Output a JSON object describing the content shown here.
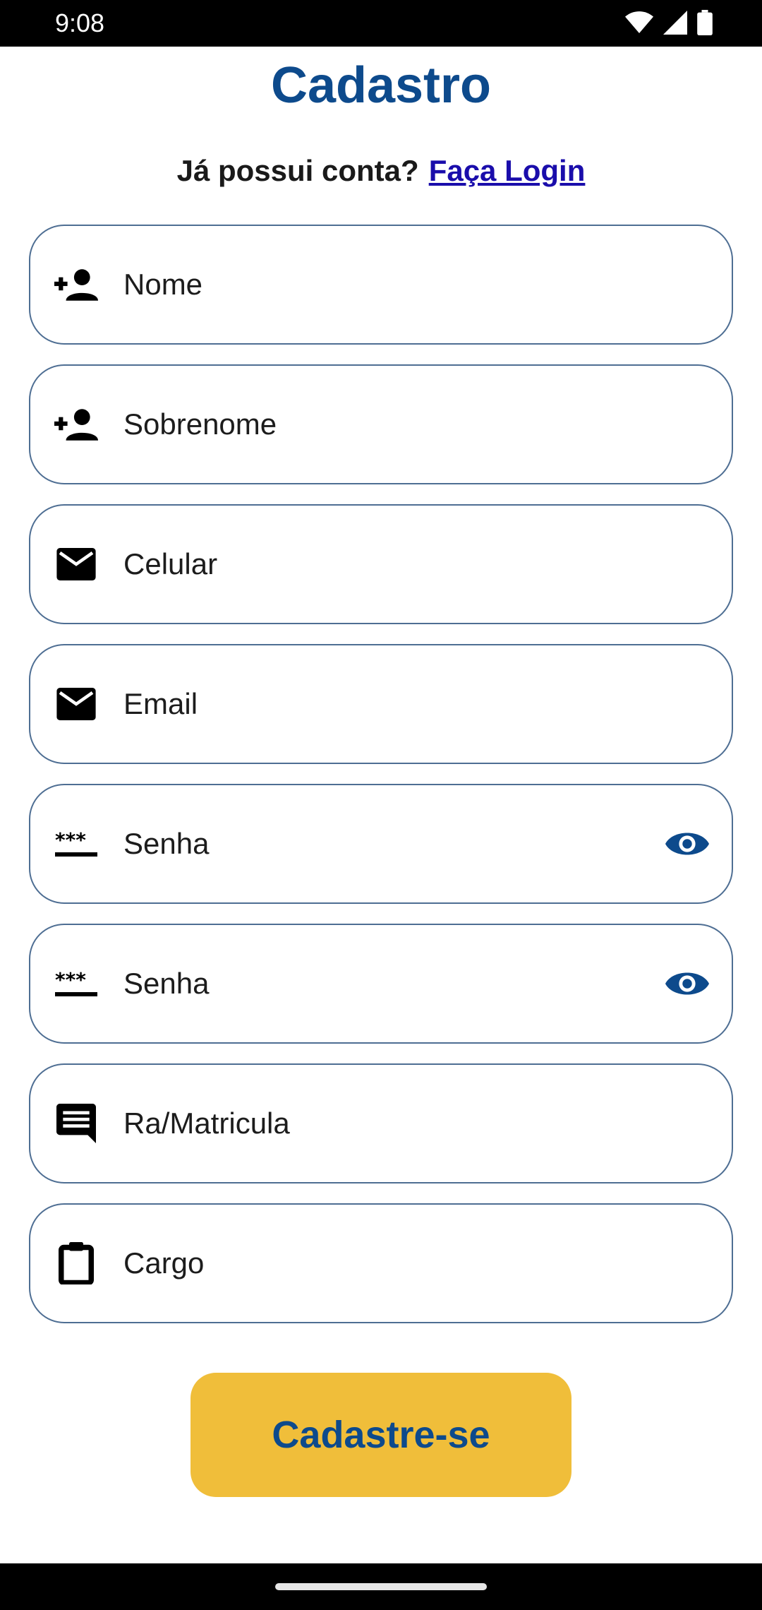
{
  "status_bar": {
    "time": "9:08",
    "icons": [
      "wifi-icon",
      "cellular-signal-icon",
      "battery-icon"
    ]
  },
  "header": {
    "title": "Cadastro",
    "login_prompt": "Já possui conta?",
    "login_link": "Faça Login"
  },
  "form": {
    "fields": [
      {
        "label": "Nome",
        "icon": "person-add-icon"
      },
      {
        "label": "Sobrenome",
        "icon": "person-add-icon"
      },
      {
        "label": "Celular",
        "icon": "mail-icon"
      },
      {
        "label": "Email",
        "icon": "mail-icon"
      },
      {
        "label": "Senha",
        "icon": "password-icon",
        "trailing_icon": "eye-icon"
      },
      {
        "label": "Senha",
        "icon": "password-icon",
        "trailing_icon": "eye-icon"
      },
      {
        "label": "Ra/Matricula",
        "icon": "chat-icon"
      },
      {
        "label": "Cargo",
        "icon": "clipboard-icon"
      }
    ],
    "submit_label": "Cadastre-se"
  },
  "colors": {
    "primary": "#0d4a8c",
    "accent": "#f0be3a",
    "link": "#1a0dab",
    "field_border": "#4e6e93"
  }
}
